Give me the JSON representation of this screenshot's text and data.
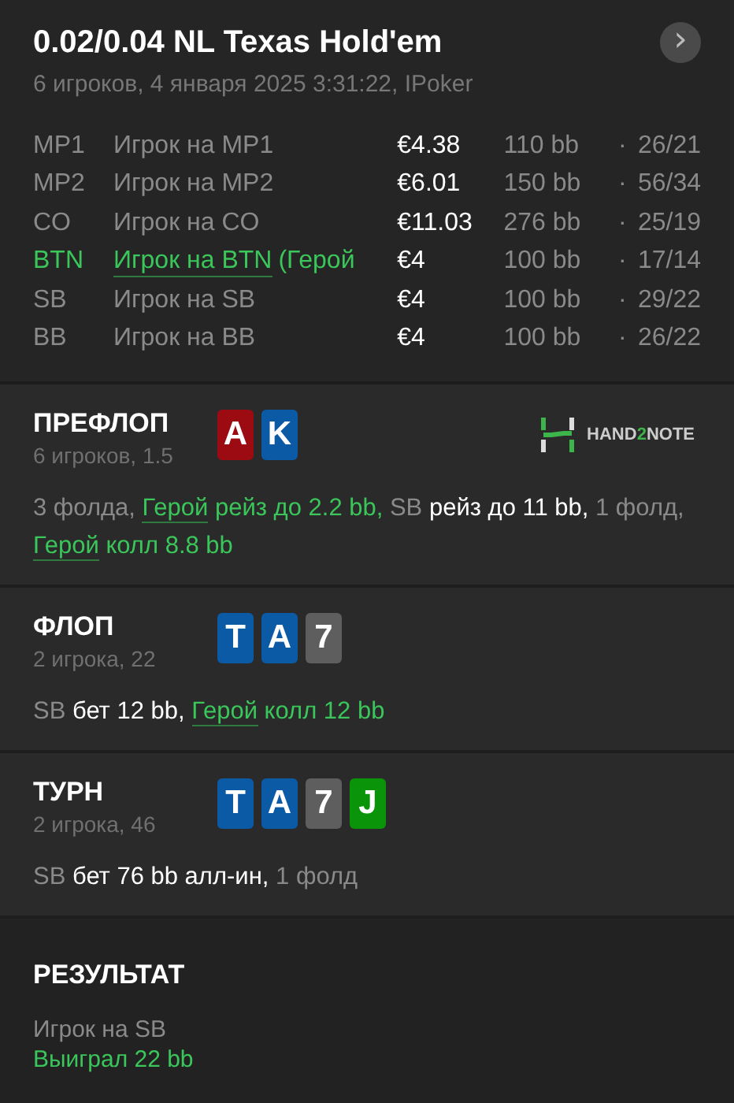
{
  "header": {
    "title": "0.02/0.04 NL Texas Hold'em",
    "subtitle": "6 игроков, 4 января 2025 3:31:22, IPoker",
    "next_button": "›"
  },
  "players": [
    {
      "position": "MP1",
      "name": "Игрок на MP1",
      "hero": false,
      "stack": "€4.38",
      "bb": "110 bb",
      "separator": "·",
      "stats": "26/21"
    },
    {
      "position": "MP2",
      "name": "Игрок на MP2",
      "hero": false,
      "stack": "€6.01",
      "bb": "150 bb",
      "separator": "·",
      "stats": "56/34"
    },
    {
      "position": "CO",
      "name": "Игрок на CO",
      "hero": false,
      "stack": "€11.03",
      "bb": "276 bb",
      "separator": "·",
      "stats": "25/19"
    },
    {
      "position": "BTN",
      "name": "Игрок на BTN",
      "hero": true,
      "hero_tag": "(Герой",
      "stack": "€4",
      "bb": "100 bb",
      "separator": "·",
      "stats": "17/14"
    },
    {
      "position": "SB",
      "name": "Игрок на SB",
      "hero": false,
      "stack": "€4",
      "bb": "100 bb",
      "separator": "·",
      "stats": "29/22"
    },
    {
      "position": "BB",
      "name": "Игрок на BB",
      "hero": false,
      "stack": "€4",
      "bb": "100 bb",
      "separator": "·",
      "stats": "26/22"
    }
  ],
  "streets": [
    {
      "title": "ПРЕФЛОП",
      "info": "6 игроков, 1.5",
      "logo": {
        "parts": [
          "HAND",
          "2",
          "NOTE"
        ]
      },
      "cards": [
        {
          "rank": "A",
          "color": "#9c0b12"
        },
        {
          "rank": "K",
          "color": "#0b5aa6"
        }
      ],
      "actions": [
        {
          "kind": "muted",
          "text": "3 фолда, "
        },
        {
          "kind": "hero_link",
          "text": "Герой"
        },
        {
          "kind": "hero",
          "text": " рейз до 2.2 bb, "
        },
        {
          "kind": "muted",
          "text": "SB"
        },
        {
          "kind": "normal",
          "text": " рейз до 11 bb, "
        },
        {
          "kind": "muted",
          "text": "1 фолд, "
        },
        {
          "kind": "hero_link",
          "text": "Герой"
        },
        {
          "kind": "hero",
          "text": " колл 8.8 bb"
        }
      ]
    },
    {
      "title": "ФЛОП",
      "info": "2 игрока, 22",
      "cards": [
        {
          "rank": "T",
          "color": "#0b5aa6"
        },
        {
          "rank": "A",
          "color": "#0b5aa6"
        },
        {
          "rank": "7",
          "color": "#5e5e5e"
        }
      ],
      "actions": [
        {
          "kind": "muted",
          "text": "SB"
        },
        {
          "kind": "normal",
          "text": " бет 12 bb, "
        },
        {
          "kind": "hero_link",
          "text": "Герой"
        },
        {
          "kind": "hero",
          "text": " колл 12 bb"
        }
      ]
    },
    {
      "title": "ТУРН",
      "info": "2 игрока, 46",
      "cards": [
        {
          "rank": "T",
          "color": "#0b5aa6"
        },
        {
          "rank": "A",
          "color": "#0b5aa6"
        },
        {
          "rank": "7",
          "color": "#5e5e5e"
        },
        {
          "rank": "J",
          "color": "#0a940a"
        }
      ],
      "actions": [
        {
          "kind": "muted",
          "text": "SB"
        },
        {
          "kind": "normal",
          "text": " бет 76 bb алл-ин, "
        },
        {
          "kind": "muted",
          "text": "1 фолд"
        }
      ]
    }
  ],
  "result": {
    "title": "РЕЗУЛЬТАТ",
    "player": "Игрок на SB",
    "outcome": "Выиграл 22 bb"
  }
}
